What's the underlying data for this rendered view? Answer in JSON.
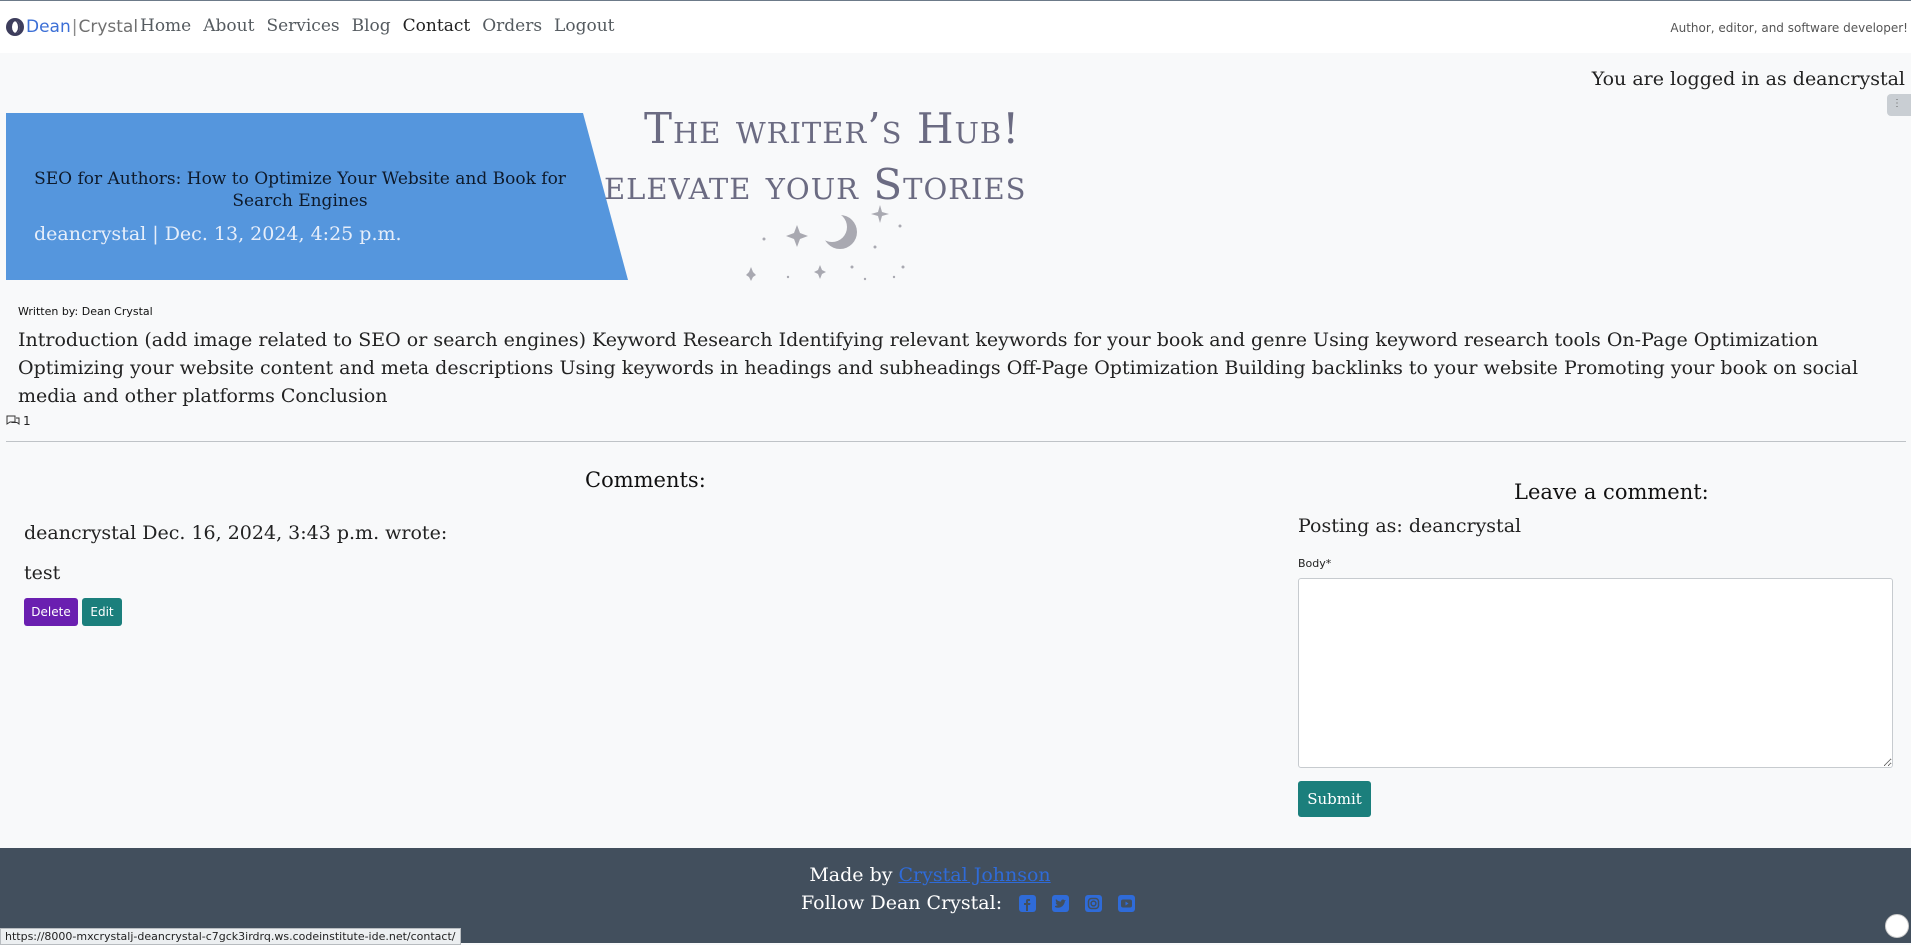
{
  "brand": {
    "dean": "Dean",
    "sep": "|",
    "crystal": "Crystal"
  },
  "nav": {
    "items": [
      {
        "label": "Home"
      },
      {
        "label": "About"
      },
      {
        "label": "Services"
      },
      {
        "label": "Blog"
      },
      {
        "label": "Contact"
      },
      {
        "label": "Orders"
      },
      {
        "label": "Logout"
      }
    ]
  },
  "tagline": "Author, editor, and software developer!",
  "login_status": "You are logged in as deancrystal",
  "hero": {
    "title": "SEO for Authors: How to Optimize Your Website and Book for Search Engines",
    "meta": "deancrystal | Dec. 13, 2024, 4:25 p.m.",
    "hub_line1": "The writer’s Hub!",
    "hub_line2": "elevate your Stories"
  },
  "post": {
    "written_by": "Written by: Dean Crystal",
    "excerpt": "Introduction (add image related to SEO or search engines) Keyword Research Identifying relevant keywords for your book and genre Using keyword research tools On-Page Optimization Optimizing your website content and meta descriptions Using keywords in headings and subheadings Off-Page Optimization Building backlinks to your website Promoting your book on social media and other platforms Conclusion",
    "comment_count": "1"
  },
  "comments": {
    "heading": "Comments:",
    "items": [
      {
        "author_line": "deancrystal Dec. 16, 2024, 3:43 p.m. wrote:",
        "body": "test",
        "delete_label": "Delete",
        "edit_label": "Edit"
      }
    ]
  },
  "comment_form": {
    "heading": "Leave a comment:",
    "posting_as": "Posting as: deancrystal",
    "body_label": "Body*",
    "body_value": "",
    "submit_label": "Submit"
  },
  "footer": {
    "made_by_prefix": "Made by",
    "made_by_link": "Crystal Johnson",
    "follow_text": "Follow Dean Crystal:",
    "social_icons": [
      "facebook-icon",
      "twitter-icon",
      "instagram-icon",
      "youtube-icon"
    ]
  },
  "status_url": "https://8000-mxcrystalj-deancrystal-c7gck3irdrq.ws.codeinstitute-ide.net/contact/",
  "colors": {
    "hero_blue": "#5596dd",
    "teal": "#1b7f7c",
    "purple": "#6a1fb0",
    "footer": "#424f5d",
    "link_blue": "#2f6bd8"
  }
}
